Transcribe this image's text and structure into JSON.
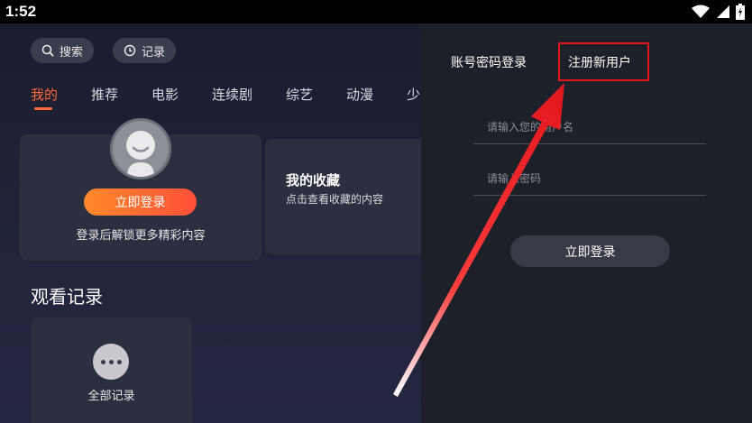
{
  "status_bar": {
    "time": "1:52",
    "icons": [
      "wifi-icon",
      "signal-icon",
      "battery-icon"
    ]
  },
  "left_panel": {
    "search_label": "搜索",
    "history_label": "记录",
    "tabs": [
      {
        "label": "我的",
        "active": true
      },
      {
        "label": "推荐",
        "active": false
      },
      {
        "label": "电影",
        "active": false
      },
      {
        "label": "连续剧",
        "active": false
      },
      {
        "label": "综艺",
        "active": false
      },
      {
        "label": "动漫",
        "active": false
      },
      {
        "label": "少",
        "active": false
      }
    ],
    "login_card": {
      "button_label": "立即登录",
      "hint": "登录后解锁更多精彩内容"
    },
    "favorites_card": {
      "title": "我的收藏",
      "subtitle": "点击查看收藏的内容"
    },
    "watch_history": {
      "title": "观看记录",
      "all_label": "全部记录"
    }
  },
  "right_panel": {
    "tab_password_login": "账号密码登录",
    "tab_register": "注册新用户",
    "username_placeholder": "请输入您的用户名",
    "password_placeholder": "请输入密码",
    "submit_label": "立即登录"
  },
  "colors": {
    "accent": "#ff6a3a",
    "login_gradient_start": "#ff8a2a",
    "login_gradient_end": "#ff4f3a",
    "annotation_red": "#e0161d"
  }
}
